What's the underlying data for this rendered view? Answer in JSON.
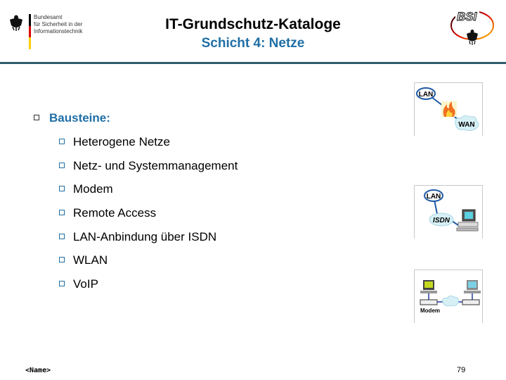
{
  "header": {
    "organization_lines": [
      "Bundesamt",
      "für Sicherheit in der",
      "Informationstechnik"
    ],
    "title": "IT-Grundschutz-Kataloge",
    "subtitle": "Schicht 4: Netze",
    "logo_right_text": "BSI"
  },
  "colors": {
    "accent_blue": "#1f6fa6",
    "header_rule": "#2e5d6b",
    "flag_black": "#000000",
    "flag_red": "#dd0000",
    "flag_gold": "#ffce00"
  },
  "content": {
    "heading": "Bausteine:",
    "items": [
      "Heterogene Netze",
      "Netz- und Systemmanagement",
      "Modem",
      "Remote Access",
      "LAN-Anbindung über ISDN",
      "WLAN",
      "VoIP"
    ]
  },
  "images": {
    "firewall": {
      "label_a": "LAN",
      "label_b": "WAN",
      "icon": "firewall-flame-icon"
    },
    "isdn": {
      "label_a": "LAN",
      "label_b": "ISDN",
      "icon": "computer-icon"
    },
    "modem": {
      "label": "Modem",
      "icon": "modem-network-icon"
    }
  },
  "footer": {
    "name": "<Name>",
    "page_number": "79"
  }
}
